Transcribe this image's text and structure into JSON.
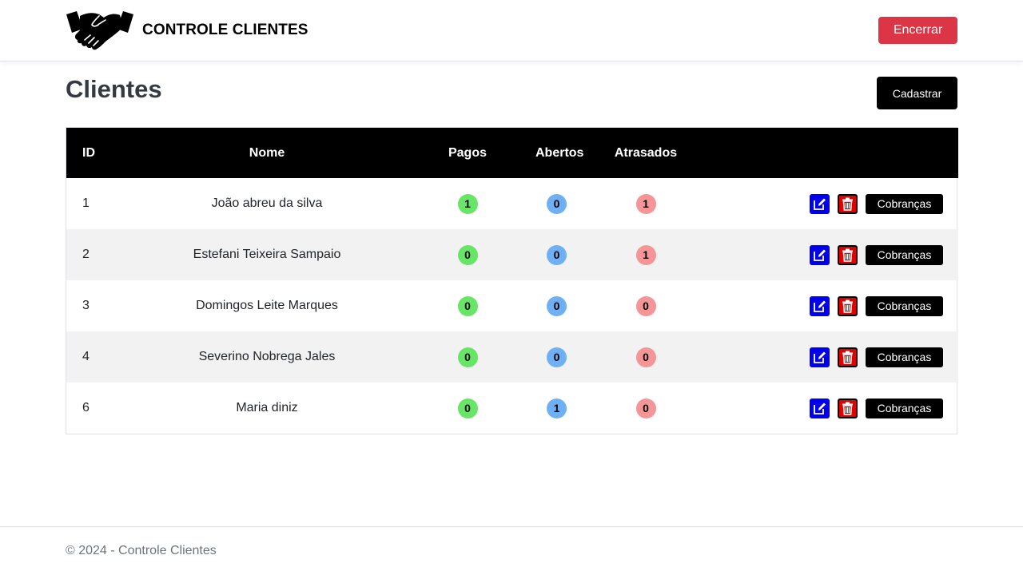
{
  "navbar": {
    "brand_icon": "handshake-icon",
    "brand_name": "CONTROLE CLIENTES",
    "logout_label": "Encerrar",
    "logout_color": "#dc3545"
  },
  "page": {
    "title": "Clientes",
    "create_label": "Cadastrar"
  },
  "table": {
    "headers": {
      "id": "ID",
      "nome": "Nome",
      "pagos": "Pagos",
      "abertos": "Abertos",
      "atrasados": "Atrasados"
    },
    "rows": [
      {
        "id": "1",
        "nome": "João abreu da silva",
        "pagos": "1",
        "abertos": "0",
        "atrasados": "1",
        "action_label": "Cobranças"
      },
      {
        "id": "2",
        "nome": "Estefani Teixeira Sampaio",
        "pagos": "0",
        "abertos": "0",
        "atrasados": "1",
        "action_label": "Cobranças"
      },
      {
        "id": "3",
        "nome": "Domingos Leite Marques",
        "pagos": "0",
        "abertos": "0",
        "atrasados": "0",
        "action_label": "Cobranças"
      },
      {
        "id": "4",
        "nome": "Severino Nobrega Jales",
        "pagos": "0",
        "abertos": "0",
        "atrasados": "0",
        "action_label": "Cobranças"
      },
      {
        "id": "6",
        "nome": "Maria diniz",
        "pagos": "0",
        "abertos": "1",
        "atrasados": "0",
        "action_label": "Cobranças"
      }
    ],
    "row_icons": [
      "edit-icon",
      "trash-icon"
    ],
    "badge_colors": {
      "pagos": "#66e566",
      "abertos": "#6fb0f5",
      "atrasados": "#f59595"
    }
  },
  "footer": {
    "text": "© 2024 - Controle Clientes"
  }
}
